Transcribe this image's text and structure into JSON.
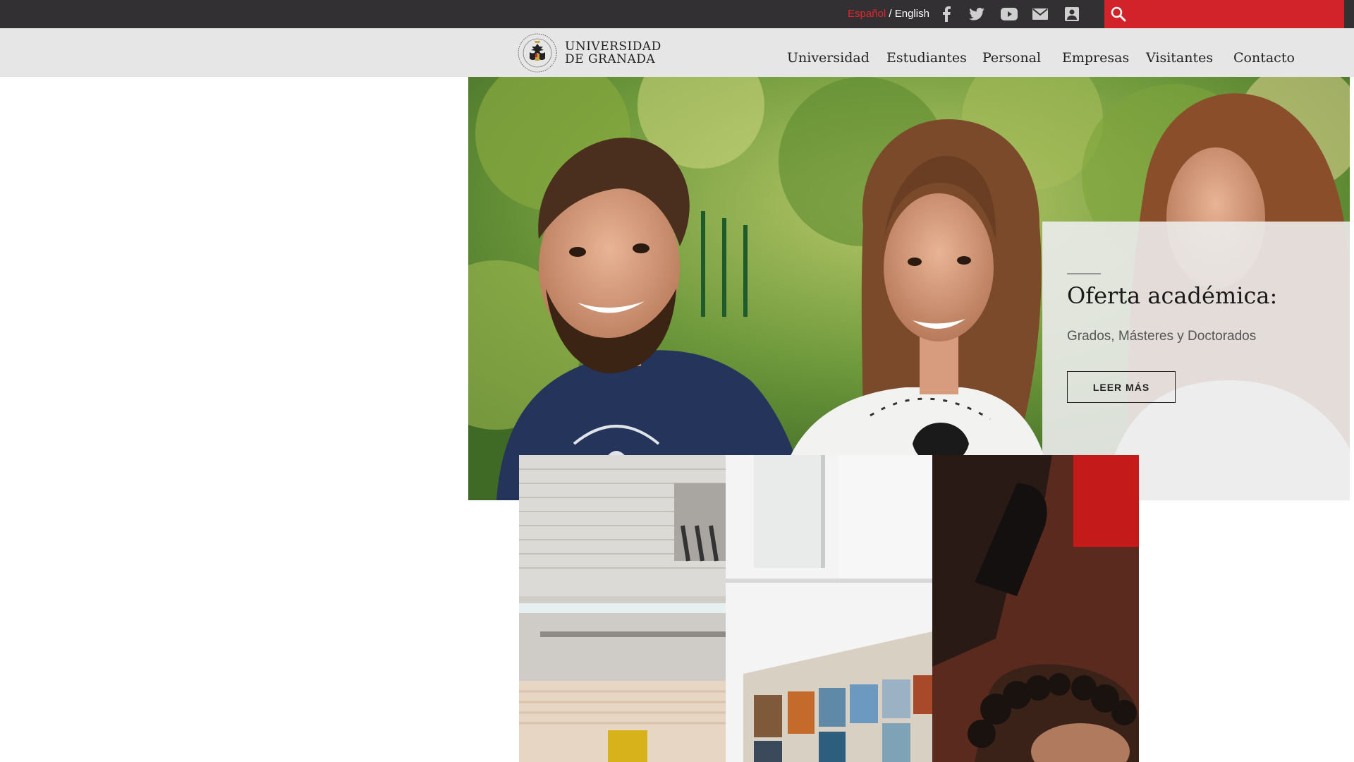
{
  "topbar": {
    "lang_es": "Español",
    "lang_sep": " / ",
    "lang_en": "English",
    "social": [
      "facebook-icon",
      "twitter-icon",
      "youtube-icon",
      "mail-icon",
      "id-card-icon"
    ],
    "search_placeholder": ""
  },
  "header": {
    "logo_line1": "UNIVERSIDAD",
    "logo_line2": "DE GRANADA",
    "nav": [
      "Universidad",
      "Estudiantes",
      "Personal",
      "Empresas",
      "Visitantes",
      "Contacto"
    ]
  },
  "hero": {
    "title": "Oferta académica:",
    "subtitle": "Grados, Másteres y Doctorados",
    "button": "LEER MÁS"
  },
  "colors": {
    "topbar": "#333033",
    "accent_red": "#d2232a",
    "header_bg": "#e6e6e6"
  }
}
